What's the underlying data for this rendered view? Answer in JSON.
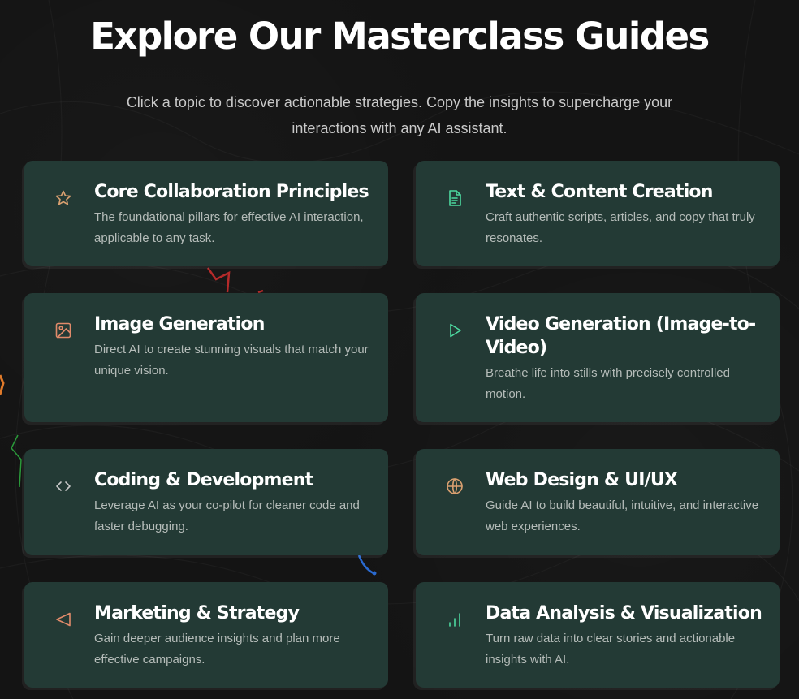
{
  "header": {
    "title": "Explore Our Masterclass Guides",
    "subtitle": "Click a topic to discover actionable strategies. Copy the insights to supercharge your interactions with any AI assistant."
  },
  "cards": [
    {
      "title": "Core Collaboration Principles",
      "description": "The foundational pillars for effective AI interaction, applicable to any task.",
      "icon": "star-icon",
      "icon_color": "#d9a070"
    },
    {
      "title": "Text & Content Creation",
      "description": "Craft authentic scripts, articles, and copy that truly resonates.",
      "icon": "document-icon",
      "icon_color": "#4cd9a0"
    },
    {
      "title": "Image Generation",
      "description": "Direct AI to create stunning visuals that match your unique vision.",
      "icon": "image-icon",
      "icon_color": "#e08a6a"
    },
    {
      "title": "Video Generation (Image-to-Video)",
      "description": "Breathe life into stills with precisely controlled motion.",
      "icon": "play-icon",
      "icon_color": "#4cd9a0"
    },
    {
      "title": "Coding & Development",
      "description": "Leverage AI as your co-pilot for cleaner code and faster debugging.",
      "icon": "code-icon",
      "icon_color": "#c9c9c9"
    },
    {
      "title": "Web Design & UI/UX",
      "description": "Guide AI to build beautiful, intuitive, and interactive web experiences.",
      "icon": "globe-icon",
      "icon_color": "#d9a070"
    },
    {
      "title": "Marketing & Strategy",
      "description": "Gain deeper audience insights and plan more effective campaigns.",
      "icon": "megaphone-icon",
      "icon_color": "#e08a6a"
    },
    {
      "title": "Data Analysis & Visualization",
      "description": "Turn raw data into clear stories and actionable insights with AI.",
      "icon": "bar-chart-icon",
      "icon_color": "#4cd9a0"
    }
  ]
}
